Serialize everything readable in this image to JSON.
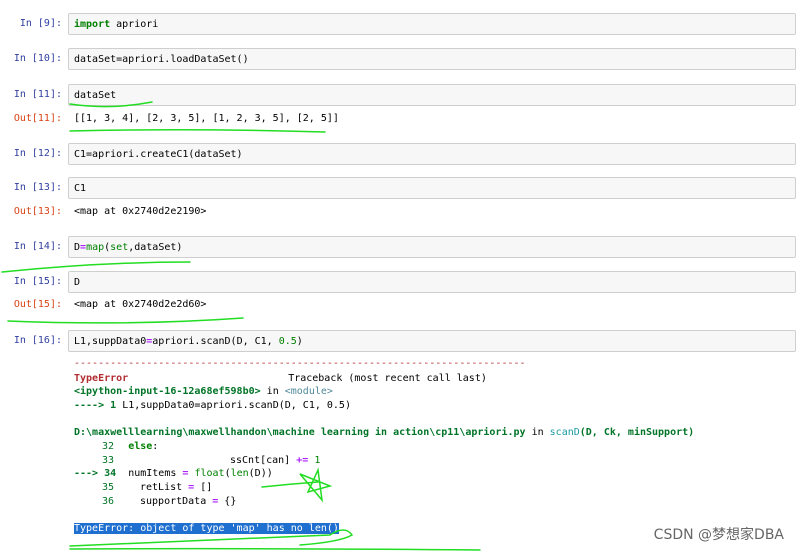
{
  "cells": [
    {
      "in_label": "In  [9]:",
      "code": "import apriori"
    },
    {
      "in_label": "In  [10]:",
      "code": "dataSet=apriori.loadDataSet()"
    },
    {
      "in_label": "In  [11]:",
      "code": "dataSet",
      "out_label": "Out[11]:",
      "output": "[[1, 3, 4], [2, 3, 5], [1, 2, 3, 5], [2, 5]]"
    },
    {
      "in_label": "In  [12]:",
      "code": "C1=apriori.createC1(dataSet)"
    },
    {
      "in_label": "In  [13]:",
      "code": "C1",
      "out_label": "Out[13]:",
      "output": "<map at 0x2740d2e2190>"
    },
    {
      "in_label": "In  [14]:",
      "code": "D=map(set,dataSet)"
    },
    {
      "in_label": "In  [15]:",
      "code": "D",
      "out_label": "Out[15]:",
      "output": "<map at 0x2740d2e2d60>"
    },
    {
      "in_label": "In  [16]:",
      "code": "L1,suppData0=apriori.scanD(D, C1, 0.5)"
    }
  ],
  "traceback": {
    "separator": "---------------------------------------------------------------------------",
    "error_type": "TypeError",
    "header_right": "Traceback (most recent call last)",
    "frame1_file": "<ipython-input-16-12a68ef598b0>",
    "frame1_in": "in",
    "frame1_module": "<module>",
    "frame1_arrow": "----> 1",
    "frame1_code": "L1,suppData0=apriori.scanD(D, C1, 0.5)",
    "frame2_path": "D:\\maxwelllearning\\maxwellhandon\\machine learning in action\\cp11\\apriori.py",
    "frame2_in": "in",
    "frame2_func": "scanD",
    "frame2_args": "(D, Ck, minSupport)",
    "lines": [
      {
        "no": "32",
        "text": "                else:"
      },
      {
        "no": "33",
        "text": "                    ssCnt[can] += 1"
      },
      {
        "no": "34",
        "arrow": "---> 34",
        "text": "numItems = float(len(D))"
      },
      {
        "no": "35",
        "text": "retList = []"
      },
      {
        "no": "36",
        "text": "supportData = {}"
      }
    ],
    "final_error": "TypeError: object of type 'map' has no len()"
  },
  "watermark": "CSDN @梦想家DBA"
}
